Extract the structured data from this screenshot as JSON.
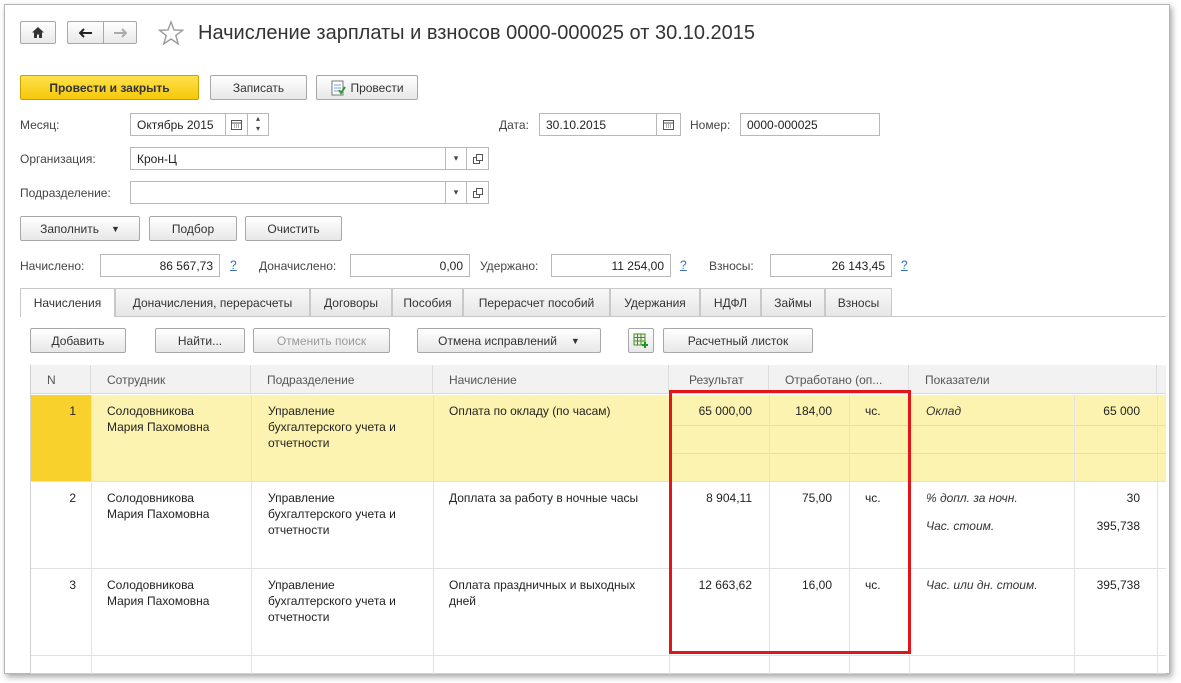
{
  "window": {
    "title": "Начисление зарплаты и взносов 0000-000025 от 30.10.2015"
  },
  "toolbar": {
    "post_close": "Провести и закрыть",
    "save": "Записать",
    "post": "Провести"
  },
  "form": {
    "month_label": "Месяц:",
    "month_value": "Октябрь 2015",
    "date_label": "Дата:",
    "date_value": "30.10.2015",
    "number_label": "Номер:",
    "number_value": "0000-000025",
    "org_label": "Организация:",
    "org_value": "Крон-Ц",
    "dept_label": "Подразделение:",
    "dept_value": ""
  },
  "actions": {
    "fill": "Заполнить",
    "select": "Подбор",
    "clear": "Очистить"
  },
  "totals": {
    "accrued_label": "Начислено:",
    "accrued_value": "86 567,73",
    "extra_label": "Доначислено:",
    "extra_value": "0,00",
    "withheld_label": "Удержано:",
    "withheld_value": "11 254,00",
    "contrib_label": "Взносы:",
    "contrib_value": "26 143,45",
    "help": "?"
  },
  "tabs": [
    "Начисления",
    "Доначисления, перерасчеты",
    "Договоры",
    "Пособия",
    "Перерасчет пособий",
    "Удержания",
    "НДФЛ",
    "Займы",
    "Взносы"
  ],
  "grid_toolbar": {
    "add": "Добавить",
    "find": "Найти...",
    "cancel_search": "Отменить поиск",
    "cancel_fix": "Отмена исправлений",
    "payslip": "Расчетный листок"
  },
  "grid": {
    "headers": {
      "n": "N",
      "employee": "Сотрудник",
      "dept": "Подразделение",
      "accrual": "Начисление",
      "result": "Результат",
      "worked": "Отработано (оп...",
      "indicators": "Показатели"
    },
    "rows": [
      {
        "n": "1",
        "emp1": "Солодовникова",
        "emp2": "Мария Пахомовна",
        "d1": "Управление",
        "d2": "бухгалтерского учета и",
        "d3": "отчетности",
        "acc1": "Оплата по окладу (по часам)",
        "acc2": "",
        "result": "65 000,00",
        "worked": "184,00",
        "unit": "чс.",
        "ind1_name": "Оклад",
        "ind1_val": "65 000",
        "ind2_name": "",
        "ind2_val": ""
      },
      {
        "n": "2",
        "emp1": "Солодовникова",
        "emp2": "Мария Пахомовна",
        "d1": "Управление",
        "d2": "бухгалтерского учета и",
        "d3": "отчетности",
        "acc1": "Доплата за работу в ночные часы",
        "acc2": "",
        "result": "8 904,11",
        "worked": "75,00",
        "unit": "чс.",
        "ind1_name": "% допл. за ночн.",
        "ind1_val": "30",
        "ind2_name": "Час. стоим.",
        "ind2_val": "395,738"
      },
      {
        "n": "3",
        "emp1": "Солодовникова",
        "emp2": "Мария Пахомовна",
        "d1": "Управление",
        "d2": "бухгалтерского учета и",
        "d3": "отчетности",
        "acc1": "Оплата праздничных и выходных",
        "acc2": "дней",
        "result": "12 663,62",
        "worked": "16,00",
        "unit": "чс.",
        "ind1_name": "Час. или дн. стоим.",
        "ind1_val": "395,738",
        "ind2_name": "",
        "ind2_val": ""
      }
    ]
  },
  "colors": {
    "highlight_row": "#fdf3b0",
    "primary_button": "#f7c80c",
    "annotation": "#e0161b",
    "link": "#2f6cc8"
  }
}
